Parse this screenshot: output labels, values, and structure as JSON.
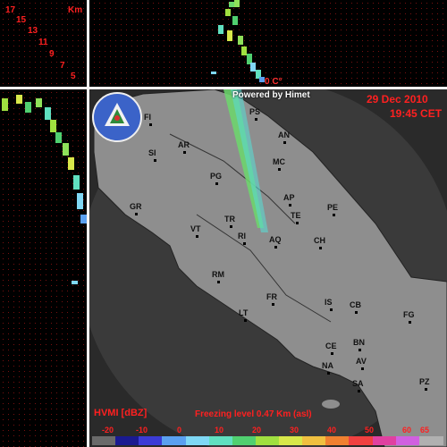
{
  "header": {
    "powered_by": "Powered by Himet",
    "date": "29 Dec 2010",
    "time": "19:45 CET",
    "freezing_level": "Freezing level 0.47 Km (asl)",
    "freezing_marker": "0 C°",
    "km_label": "Km"
  },
  "scale": [
    "17",
    "15",
    "13",
    "11",
    "9",
    "7",
    "5"
  ],
  "legend": {
    "title": "HVMI [dBZ]",
    "labels": [
      "-20",
      "-10",
      "0",
      "10",
      "20",
      "30",
      "40",
      "50",
      "60",
      "65"
    ],
    "colors": [
      "#6a6a6a",
      "#1a1a90",
      "#3b3bd6",
      "#5aa0f0",
      "#7fd8f5",
      "#60e0c0",
      "#50d070",
      "#a0e040",
      "#d8e84a",
      "#f0c040",
      "#f08030",
      "#f04040",
      "#e040a0",
      "#d060e0",
      "#b0b0b0"
    ]
  },
  "cities": [
    {
      "code": "FI"
    },
    {
      "code": "PS"
    },
    {
      "code": "AN"
    },
    {
      "code": "SI"
    },
    {
      "code": "AR"
    },
    {
      "code": "MC"
    },
    {
      "code": "PG"
    },
    {
      "code": "GR"
    },
    {
      "code": "AP"
    },
    {
      "code": "TE"
    },
    {
      "code": "TR"
    },
    {
      "code": "VT"
    },
    {
      "code": "RI"
    },
    {
      "code": "PE"
    },
    {
      "code": "AQ"
    },
    {
      "code": "CH"
    },
    {
      "code": "RM"
    },
    {
      "code": "FR"
    },
    {
      "code": "IS"
    },
    {
      "code": "CB"
    },
    {
      "code": "FG"
    },
    {
      "code": "LT"
    },
    {
      "code": "CE"
    },
    {
      "code": "BN"
    },
    {
      "code": "NA"
    },
    {
      "code": "AV"
    },
    {
      "code": "SA"
    },
    {
      "code": "PZ"
    }
  ],
  "colors": {
    "panel_bg": "#000000",
    "label_red": "#ff2020",
    "land_grey": "#9a9a9a",
    "sea_grey": "#4a4a4a"
  }
}
